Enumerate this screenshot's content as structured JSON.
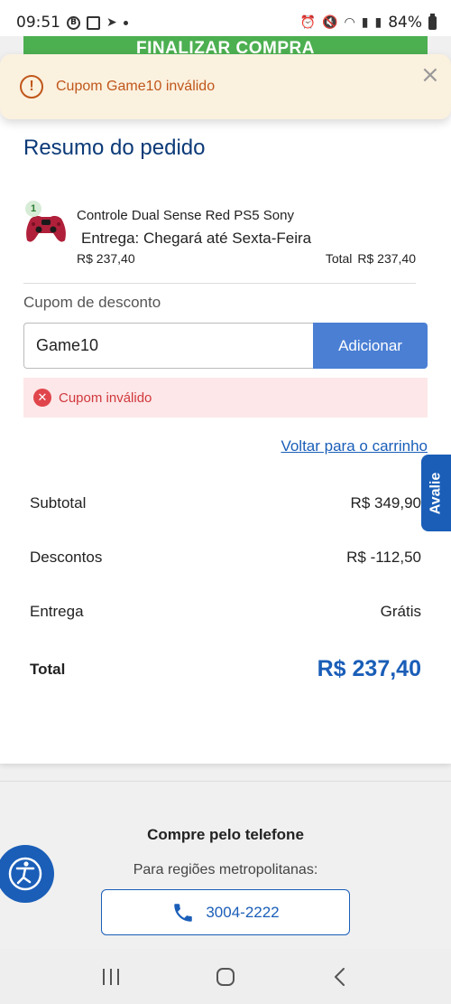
{
  "status_bar": {
    "time": "09:51",
    "battery": "84%"
  },
  "header": {
    "finalize_label": "FINALIZAR COMPRA"
  },
  "toast": {
    "message": "Cupom Game10 inválido",
    "icon": "alert-circle-icon",
    "color": "#c0571b"
  },
  "summary": {
    "title": "Resumo do pedido",
    "product": {
      "quantity": "1",
      "name": "Controle Dual Sense Red PS5 Sony",
      "delivery": "Entrega: Chegará até Sexta-Feira",
      "price": "R$ 237,40",
      "total_label": "Total",
      "total_value": "R$ 237,40"
    }
  },
  "coupon": {
    "label": "Cupom de desconto",
    "value": "Game10",
    "button_label": "Adicionar",
    "error": "Cupom inválido"
  },
  "back_link": "Voltar para o carrinho",
  "avalie_tab": "Avalie",
  "totals": {
    "subtotal_label": "Subtotal",
    "subtotal_value": "R$ 349,90",
    "discount_label": "Descontos",
    "discount_value": "R$ -112,50",
    "delivery_label": "Entrega",
    "delivery_value": "Grátis",
    "total_label": "Total",
    "total_value": "R$ 237,40"
  },
  "footer": {
    "phone_title": "Compre pelo telefone",
    "phone_sub": "Para regiões metropolitanas:",
    "phone_number": "3004-2222"
  },
  "colors": {
    "brand_blue": "#1a5eb8",
    "finalize_green": "#4caf50",
    "error_red": "#e0454b"
  }
}
